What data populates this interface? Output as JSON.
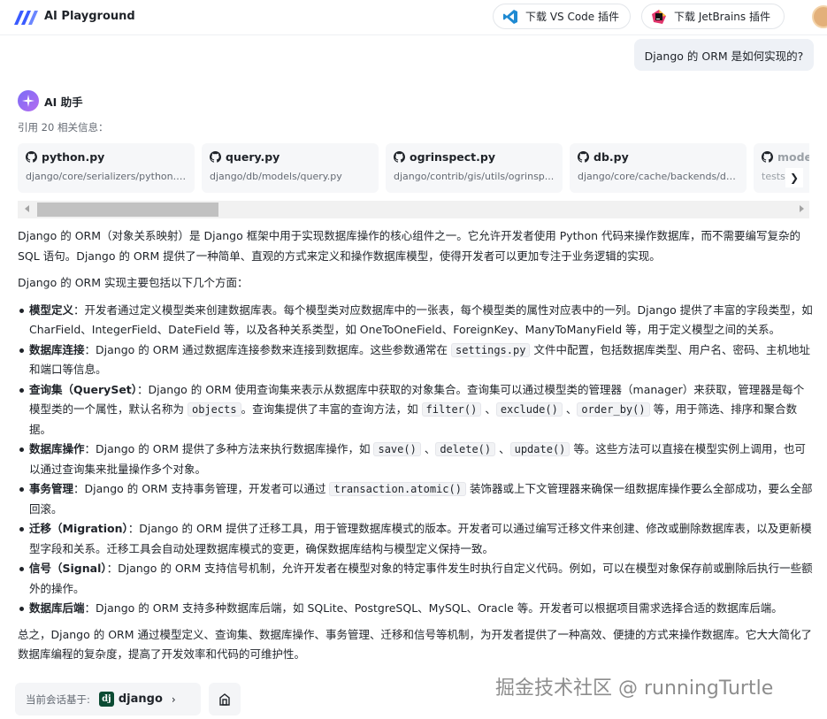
{
  "header": {
    "app_title": "AI Playground",
    "vscode_label": "下载 VS Code 插件",
    "jetbrains_label": "下载 JetBrains 插件"
  },
  "user_message": "Django 的 ORM 是如何实现的?",
  "assistant": {
    "name": "AI 助手",
    "ref_count": "引用 20 相关信息：",
    "refs": [
      {
        "name": "python.py",
        "path": "django/core/serializers/python.py"
      },
      {
        "name": "query.py",
        "path": "django/db/models/query.py"
      },
      {
        "name": "ogrinspect.py",
        "path": "django/contrib/gis/utils/ogrinsp..."
      },
      {
        "name": "db.py",
        "path": "django/core/cache/backends/db..."
      },
      {
        "name": "mode",
        "path": "tests/a"
      }
    ],
    "intro": "Django 的 ORM（对象关系映射）是 Django 框架中用于实现数据库操作的核心组件之一。它允许开发者使用 Python 代码来操作数据库，而不需要编写复杂的 SQL 语句。Django 的 ORM 提供了一种简单、直观的方式来定义和操作数据库模型，使得开发者可以更加专注于业务逻辑的实现。",
    "lead": "Django 的 ORM 实现主要包括以下几个方面：",
    "items": {
      "i1_title": "模型定义",
      "i1_text": "：开发者通过定义模型类来创建数据库表。每个模型类对应数据库中的一张表，每个模型类的属性对应表中的一列。Django 提供了丰富的字段类型，如 CharField、IntegerField、DateField 等，以及各种关系类型，如 OneToOneField、ForeignKey、ManyToManyField 等，用于定义模型之间的关系。",
      "i2_title": "数据库连接",
      "i2_a": "：Django 的 ORM 通过数据库连接参数来连接到数据库。这些参数通常在 ",
      "i2_code": "settings.py",
      "i2_b": " 文件中配置，包括数据库类型、用户名、密码、主机地址和端口等信息。",
      "i3_title": "查询集（QuerySet）",
      "i3_a": "：Django 的 ORM 使用查询集来表示从数据库中获取的对象集合。查询集可以通过模型类的管理器（manager）来获取，管理器是每个模型类的一个属性，默认名称为 ",
      "i3_code1": "objects",
      "i3_b": "。查询集提供了丰富的查询方法，如 ",
      "i3_code2": "filter()",
      "i3_sep1": " 、",
      "i3_code3": "exclude()",
      "i3_sep2": " 、",
      "i3_code4": "order_by()",
      "i3_c": " 等，用于筛选、排序和聚合数据。",
      "i4_title": "数据库操作",
      "i4_a": "：Django 的 ORM 提供了多种方法来执行数据库操作，如 ",
      "i4_code1": "save()",
      "i4_sep1": " 、",
      "i4_code2": "delete()",
      "i4_sep2": " 、",
      "i4_code3": "update()",
      "i4_b": " 等。这些方法可以直接在模型实例上调用，也可以通过查询集来批量操作多个对象。",
      "i5_title": "事务管理",
      "i5_a": "：Django 的 ORM 支持事务管理，开发者可以通过 ",
      "i5_code": "transaction.atomic()",
      "i5_b": " 装饰器或上下文管理器来确保一组数据库操作要么全部成功，要么全部回滚。",
      "i6_title": "迁移（Migration）",
      "i6_text": "：Django 的 ORM 提供了迁移工具，用于管理数据库模式的版本。开发者可以通过编写迁移文件来创建、修改或删除数据库表，以及更新模型字段和关系。迁移工具会自动处理数据库模式的变更，确保数据库结构与模型定义保持一致。",
      "i7_title": "信号（Signal）",
      "i7_text": "：Django 的 ORM 支持信号机制，允许开发者在模型对象的特定事件发生时执行自定义代码。例如，可以在模型对象保存前或删除后执行一些额外的操作。",
      "i8_title": "数据库后端",
      "i8_text": "：Django 的 ORM 支持多种数据库后端，如 SQLite、PostgreSQL、MySQL、Oracle 等。开发者可以根据项目需求选择合适的数据库后端。"
    },
    "summary": "总之，Django 的 ORM 通过模型定义、查询集、数据库操作、事务管理、迁移和信号等机制，为开发者提供了一种高效、便捷的方式来操作数据库。它大大简化了数据库编程的复杂度，提高了开发效率和代码的可维护性。"
  },
  "context": {
    "label": "当前会话基于:",
    "icon_letter": "dj",
    "name": "django"
  },
  "watermark": "掘金技术社区 @ runningTurtle"
}
